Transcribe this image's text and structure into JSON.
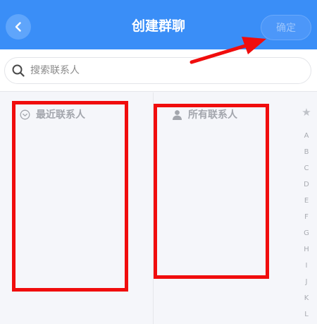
{
  "header": {
    "title": "创建群聊",
    "confirm_label": "确定"
  },
  "search": {
    "placeholder": "搜索联系人"
  },
  "recent": {
    "label": "最近联系人"
  },
  "all": {
    "label": "所有联系人"
  },
  "index_bar": {
    "star": "★",
    "letters": [
      "A",
      "B",
      "C",
      "D",
      "E",
      "F",
      "G",
      "H",
      "I",
      "J",
      "K",
      "L"
    ]
  },
  "colors": {
    "header_bg": "#3a8ef7",
    "annotation": "#f00d0d"
  }
}
